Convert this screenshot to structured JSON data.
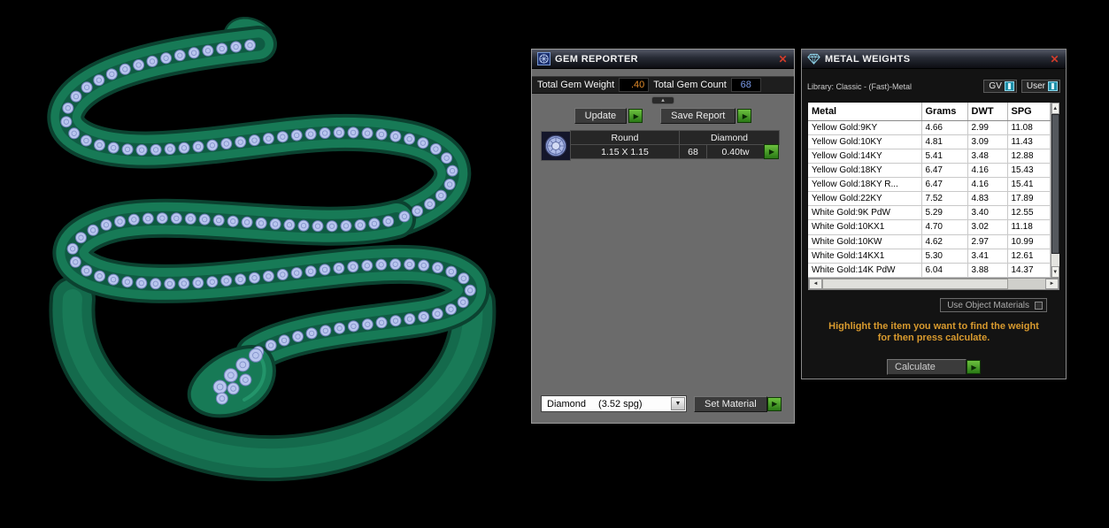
{
  "icons": {
    "close": "✕",
    "go": "▶",
    "dropdown_arrow": "▼",
    "caret_up": "▴",
    "scroll_up": "▲",
    "scroll_down": "▼",
    "scroll_left": "◄",
    "scroll_right": "►"
  },
  "gem_reporter": {
    "title": "GEM REPORTER",
    "total_gem_weight_label": "Total Gem Weight",
    "total_gem_weight_value": ".40",
    "total_gem_count_label": "Total Gem Count",
    "total_gem_count_value": "68",
    "update_label": "Update",
    "save_report_label": "Save Report",
    "table": {
      "shape_header": "Round",
      "type_header": "Diamond",
      "size": "1.15 X 1.15",
      "count": "68",
      "weight": "0.40tw"
    },
    "material_name": "Diamond",
    "material_spg": "(3.52 spg)",
    "set_material_label": "Set Material"
  },
  "metal_weights": {
    "title": "METAL WEIGHTS",
    "library_label": "Library: Classic - (Fast)-Metal",
    "gv_label": "GV",
    "user_label": "User",
    "columns": [
      "Metal",
      "Grams",
      "DWT",
      "SPG"
    ],
    "rows": [
      {
        "metal": "Yellow Gold:9KY",
        "grams": "4.66",
        "dwt": "2.99",
        "spg": "11.08"
      },
      {
        "metal": "Yellow Gold:10KY",
        "grams": "4.81",
        "dwt": "3.09",
        "spg": "11.43"
      },
      {
        "metal": "Yellow Gold:14KY",
        "grams": "5.41",
        "dwt": "3.48",
        "spg": "12.88"
      },
      {
        "metal": "Yellow Gold:18KY",
        "grams": "6.47",
        "dwt": "4.16",
        "spg": "15.43"
      },
      {
        "metal": "Yellow Gold:18KY R...",
        "grams": "6.47",
        "dwt": "4.16",
        "spg": "15.41"
      },
      {
        "metal": "Yellow Gold:22KY",
        "grams": "7.52",
        "dwt": "4.83",
        "spg": "17.89"
      },
      {
        "metal": "White Gold:9K PdW",
        "grams": "5.29",
        "dwt": "3.40",
        "spg": "12.55"
      },
      {
        "metal": "White Gold:10KX1",
        "grams": "4.70",
        "dwt": "3.02",
        "spg": "11.18"
      },
      {
        "metal": "White Gold:10KW",
        "grams": "4.62",
        "dwt": "2.97",
        "spg": "10.99"
      },
      {
        "metal": "White Gold:14KX1",
        "grams": "5.30",
        "dwt": "3.41",
        "spg": "12.61"
      },
      {
        "metal": "White Gold:14K PdW",
        "grams": "6.04",
        "dwt": "3.88",
        "spg": "14.37"
      }
    ],
    "use_object_materials_label": "Use Object Materials",
    "instruction_line1": "Highlight the item you want to find the weight",
    "instruction_line2": "for then press calculate.",
    "calculate_label": "Calculate"
  },
  "colors": {
    "accent_green": "#2e8b1e",
    "warning_text": "#d89a2e",
    "weight_value": "#e08a2a",
    "count_value": "#7a9ae8",
    "ring_green": "#15714f",
    "gem_blue": "#b9c6ee"
  }
}
